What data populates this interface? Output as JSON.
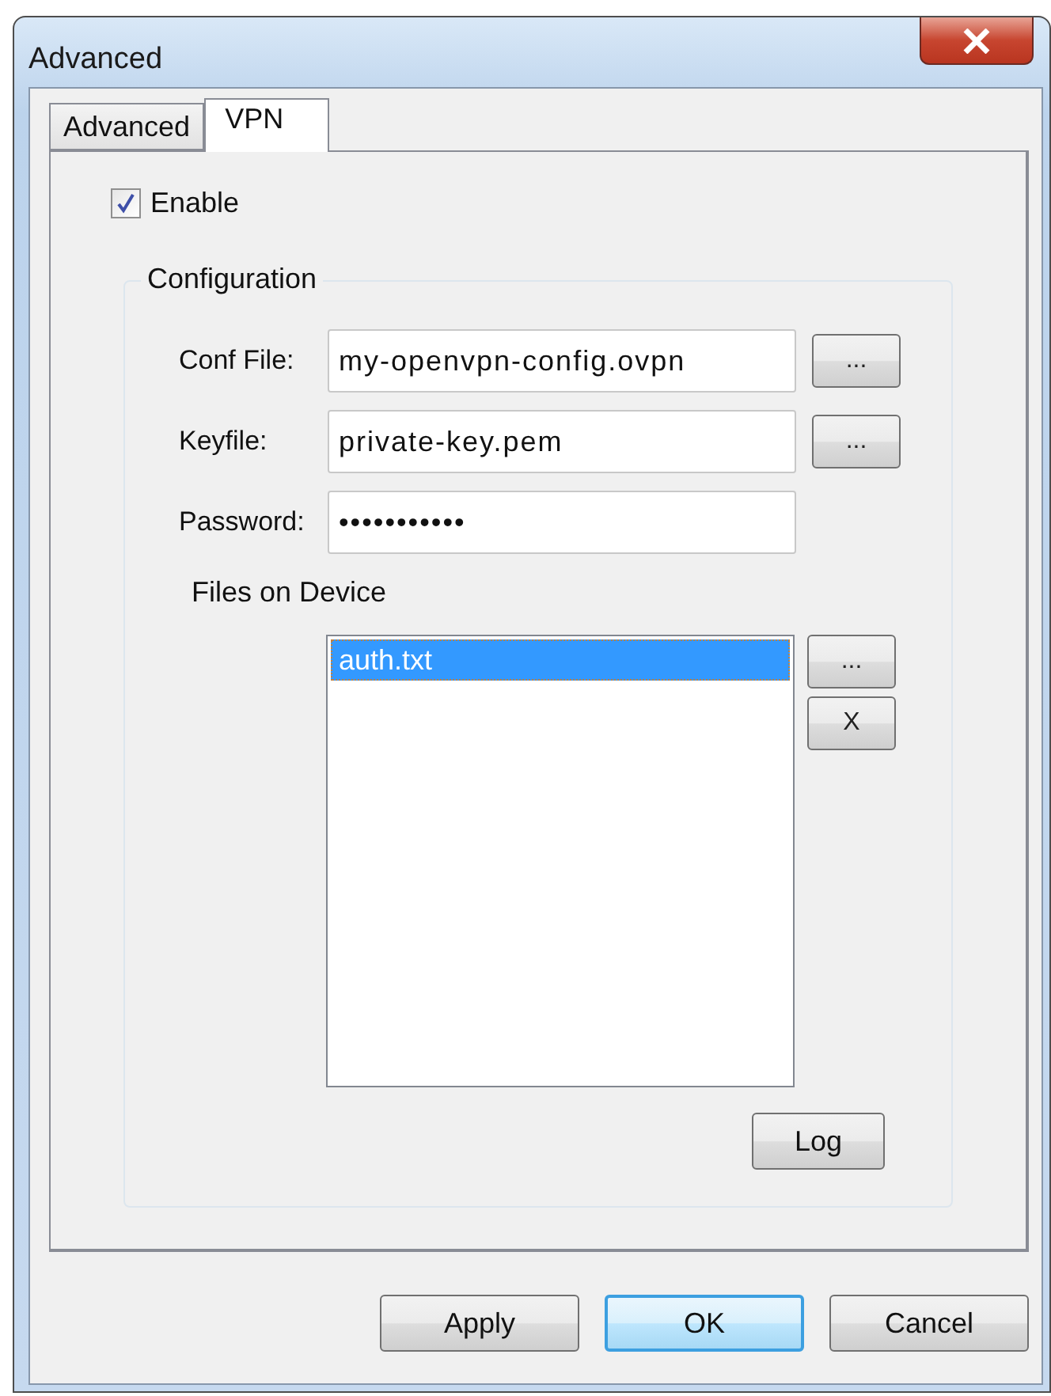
{
  "window": {
    "title": "Advanced"
  },
  "tabs": [
    {
      "label": "Advanced",
      "selected": false
    },
    {
      "label": "VPN",
      "selected": true
    }
  ],
  "enable": {
    "label": "Enable",
    "checked": true
  },
  "configuration": {
    "title": "Configuration",
    "fields": [
      {
        "label": "Conf File:",
        "value": "my-openvpn-config.ovpn",
        "browse": "..."
      },
      {
        "label": "Keyfile:",
        "value": "private-key.pem",
        "browse": "..."
      },
      {
        "label": "Password:",
        "value": "•••••••••••"
      }
    ],
    "files_label": "Files on Device",
    "files": [
      {
        "name": "auth.txt",
        "selected": true
      }
    ],
    "file_buttons": [
      "...",
      "X"
    ],
    "log_button": "Log"
  },
  "buttons": [
    {
      "label": "Apply",
      "default": false
    },
    {
      "label": "OK",
      "default": true
    },
    {
      "label": "Cancel",
      "default": false
    }
  ]
}
